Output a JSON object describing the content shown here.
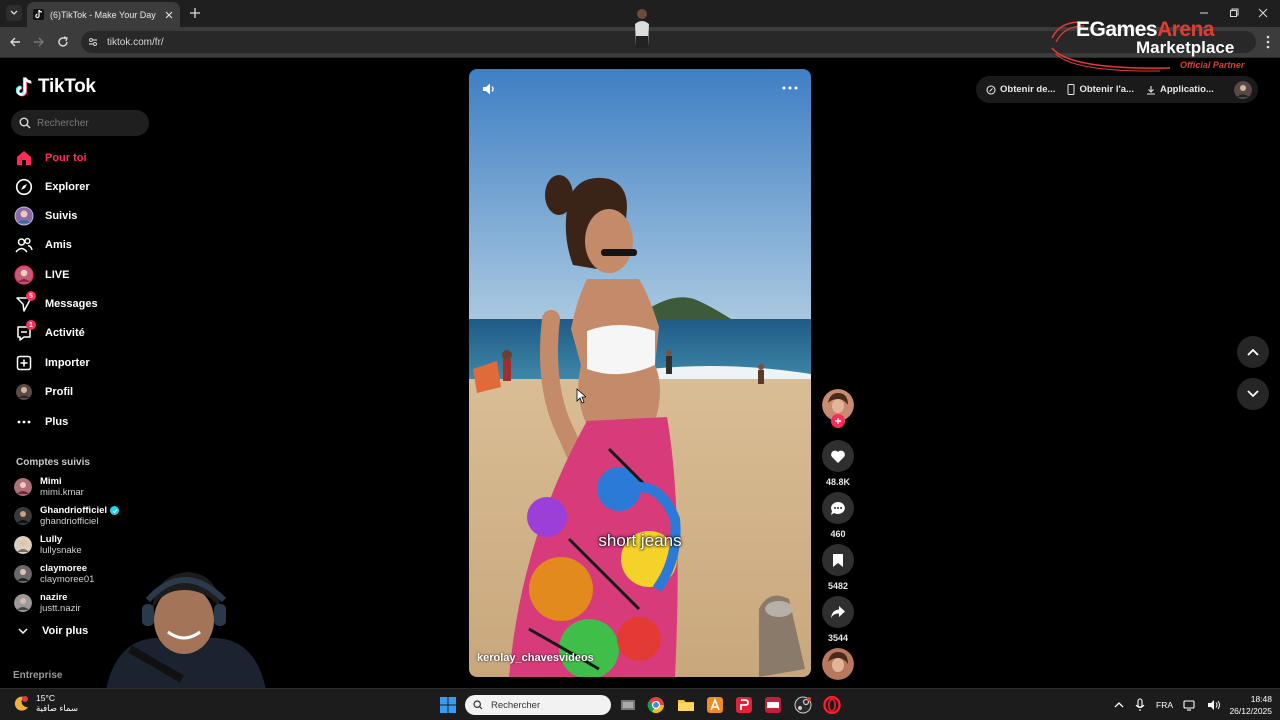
{
  "browser": {
    "tab_title": "(6)TikTok - Make Your Day",
    "url": "tiktok.com/fr/"
  },
  "overlay": {
    "brand_part1": "EGames",
    "brand_part2": "Arena",
    "brand_line2": "Marketplace",
    "brand_tag": "Official Partner"
  },
  "tiktok": {
    "logo_text": "TikTok",
    "search_placeholder": "Rechercher",
    "nav": [
      {
        "label": "Pour toi",
        "icon": "home-icon",
        "active": true
      },
      {
        "label": "Explorer",
        "icon": "compass-icon"
      },
      {
        "label": "Suivis",
        "icon": "following-avatar-icon"
      },
      {
        "label": "Amis",
        "icon": "friends-icon"
      },
      {
        "label": "LIVE",
        "icon": "live-avatar-icon"
      },
      {
        "label": "Messages",
        "icon": "messages-icon",
        "badge": "5"
      },
      {
        "label": "Activité",
        "icon": "activity-icon",
        "badge": "1"
      },
      {
        "label": "Importer",
        "icon": "upload-icon"
      },
      {
        "label": "Profil",
        "icon": "profile-avatar-icon"
      },
      {
        "label": "Plus",
        "icon": "more-dots-icon"
      }
    ],
    "followed_title": "Comptes suivis",
    "followed": [
      {
        "name": "Mimi",
        "handle": "mimi.kmar"
      },
      {
        "name": "Ghandriofficiel",
        "handle": "ghandriofficiel",
        "verified": true
      },
      {
        "name": "Lully",
        "handle": "lullysnake"
      },
      {
        "name": "claymoree",
        "handle": "claymoree01"
      },
      {
        "name": "nazire",
        "handle": "justt.nazir"
      }
    ],
    "see_more": "Voir plus",
    "enterprise": "Entreprise",
    "video": {
      "caption": "short jeans",
      "author": "kerolay_chavesvideos"
    },
    "actions": {
      "likes": "48.8K",
      "comments": "460",
      "saves": "5482",
      "shares": "3544"
    },
    "top_pills": [
      "Obtenir de...",
      "Obtenir l'a...",
      "Applicatio..."
    ]
  },
  "taskbar": {
    "weather_temp": "15°C",
    "weather_desc": "سماء صافية",
    "search_placeholder": "Rechercher",
    "language": "FRA",
    "time": "18:48",
    "date": "26/12/2025"
  },
  "colors": {
    "accent": "#fe2c55",
    "bg": "#000000",
    "overlay_red": "#e33b33"
  }
}
